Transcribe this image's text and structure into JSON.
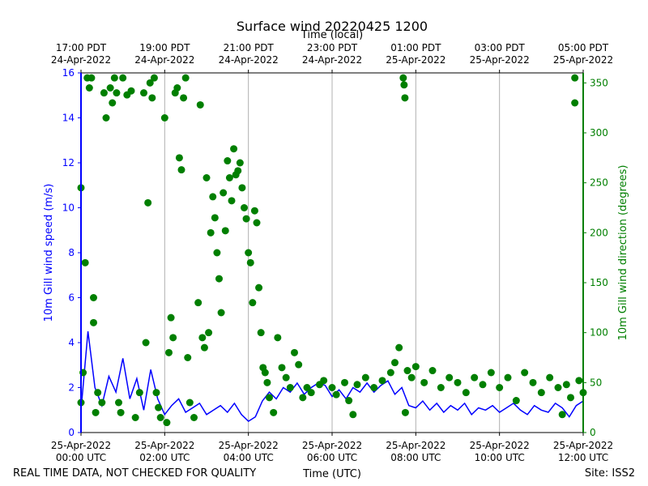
{
  "chart_data": {
    "type": "line+scatter",
    "title": "Surface wind 20220425 1200",
    "top_xlabel": "Time (local)",
    "xlabel": "Time (UTC)",
    "ylabel_left": "10m Gill wind speed (m/s)",
    "ylabel_right": "10m Gill wind direction (degrees)",
    "footer_left": "REAL TIME DATA, NOT CHECKED FOR QUALITY",
    "footer_right": "Site: ISS2",
    "xlim_hours": [
      0,
      12
    ],
    "ylim_left": [
      0,
      16
    ],
    "ylim_right": [
      0,
      360
    ],
    "left_ticks": [
      "0",
      "2",
      "4",
      "6",
      "8",
      "10",
      "12",
      "14",
      "16"
    ],
    "right_ticks": [
      "0",
      "50",
      "100",
      "150",
      "200",
      "250",
      "300",
      "350"
    ],
    "bottom_ticks": [
      [
        "25-Apr-2022",
        "00:00 UTC"
      ],
      [
        "25-Apr-2022",
        "02:00 UTC"
      ],
      [
        "25-Apr-2022",
        "04:00 UTC"
      ],
      [
        "25-Apr-2022",
        "06:00 UTC"
      ],
      [
        "25-Apr-2022",
        "08:00 UTC"
      ],
      [
        "25-Apr-2022",
        "10:00 UTC"
      ],
      [
        "25-Apr-2022",
        "12:00 UTC"
      ]
    ],
    "top_ticks": [
      [
        "17:00 PDT",
        "24-Apr-2022"
      ],
      [
        "19:00 PDT",
        "24-Apr-2022"
      ],
      [
        "21:00 PDT",
        "24-Apr-2022"
      ],
      [
        "23:00 PDT",
        "24-Apr-2022"
      ],
      [
        "01:00 PDT",
        "25-Apr-2022"
      ],
      [
        "03:00 PDT",
        "25-Apr-2022"
      ],
      [
        "05:00 PDT",
        "25-Apr-2022"
      ]
    ],
    "colors": {
      "speed": "#0000ff",
      "direction": "#007f00",
      "grid": "#b0b0b0"
    },
    "speed_interval_min": 10,
    "speed": [
      1.0,
      4.5,
      2.0,
      1.2,
      2.5,
      1.8,
      3.3,
      1.5,
      2.4,
      1.0,
      2.8,
      1.5,
      0.8,
      1.2,
      1.5,
      0.9,
      1.1,
      1.3,
      0.8,
      1.0,
      1.2,
      0.9,
      1.3,
      0.8,
      0.5,
      0.7,
      1.4,
      1.8,
      1.5,
      2.0,
      1.8,
      2.2,
      1.7,
      2.0,
      2.2,
      2.1,
      1.6,
      1.9,
      1.5,
      2.0,
      1.8,
      2.2,
      1.8,
      2.1,
      2.3,
      1.7,
      2.0,
      1.2,
      1.1,
      1.4,
      1.0,
      1.3,
      0.9,
      1.2,
      1.0,
      1.3,
      0.8,
      1.1,
      1.0,
      1.2,
      0.9,
      1.1,
      1.3,
      1.0,
      0.8,
      1.2,
      1.0,
      0.9,
      1.3,
      1.1,
      0.7,
      1.2,
      1.4
    ],
    "direction": [
      [
        0.0,
        245
      ],
      [
        0.0,
        30
      ],
      [
        0.05,
        60
      ],
      [
        0.1,
        170
      ],
      [
        0.15,
        355
      ],
      [
        0.2,
        345
      ],
      [
        0.25,
        355
      ],
      [
        0.3,
        135
      ],
      [
        0.3,
        110
      ],
      [
        0.35,
        20
      ],
      [
        0.4,
        40
      ],
      [
        0.5,
        30
      ],
      [
        0.55,
        340
      ],
      [
        0.6,
        315
      ],
      [
        0.7,
        345
      ],
      [
        0.75,
        330
      ],
      [
        0.8,
        355
      ],
      [
        0.85,
        340
      ],
      [
        0.9,
        30
      ],
      [
        0.95,
        20
      ],
      [
        1.0,
        355
      ],
      [
        1.1,
        338
      ],
      [
        1.2,
        342
      ],
      [
        1.3,
        15
      ],
      [
        1.4,
        40
      ],
      [
        1.5,
        340
      ],
      [
        1.55,
        90
      ],
      [
        1.6,
        230
      ],
      [
        1.65,
        350
      ],
      [
        1.7,
        335
      ],
      [
        1.75,
        355
      ],
      [
        1.8,
        40
      ],
      [
        1.85,
        25
      ],
      [
        1.9,
        15
      ],
      [
        2.0,
        315
      ],
      [
        2.05,
        10
      ],
      [
        2.1,
        80
      ],
      [
        2.15,
        115
      ],
      [
        2.2,
        95
      ],
      [
        2.25,
        340
      ],
      [
        2.3,
        345
      ],
      [
        2.35,
        275
      ],
      [
        2.4,
        263
      ],
      [
        2.45,
        335
      ],
      [
        2.5,
        355
      ],
      [
        2.55,
        75
      ],
      [
        2.6,
        30
      ],
      [
        2.7,
        15
      ],
      [
        2.8,
        130
      ],
      [
        2.85,
        328
      ],
      [
        2.9,
        95
      ],
      [
        2.95,
        85
      ],
      [
        3.0,
        255
      ],
      [
        3.05,
        100
      ],
      [
        3.1,
        200
      ],
      [
        3.15,
        236
      ],
      [
        3.2,
        215
      ],
      [
        3.25,
        180
      ],
      [
        3.3,
        154
      ],
      [
        3.35,
        120
      ],
      [
        3.4,
        240
      ],
      [
        3.45,
        202
      ],
      [
        3.5,
        272
      ],
      [
        3.55,
        255
      ],
      [
        3.6,
        232
      ],
      [
        3.65,
        284
      ],
      [
        3.7,
        258
      ],
      [
        3.75,
        262
      ],
      [
        3.8,
        270
      ],
      [
        3.85,
        245
      ],
      [
        3.9,
        225
      ],
      [
        3.95,
        214
      ],
      [
        4.0,
        180
      ],
      [
        4.05,
        170
      ],
      [
        4.1,
        130
      ],
      [
        4.15,
        222
      ],
      [
        4.2,
        210
      ],
      [
        4.25,
        145
      ],
      [
        4.3,
        100
      ],
      [
        4.35,
        65
      ],
      [
        4.4,
        60
      ],
      [
        4.45,
        50
      ],
      [
        4.5,
        35
      ],
      [
        4.6,
        20
      ],
      [
        4.7,
        95
      ],
      [
        4.8,
        65
      ],
      [
        4.9,
        55
      ],
      [
        5.0,
        45
      ],
      [
        5.1,
        80
      ],
      [
        5.2,
        68
      ],
      [
        5.3,
        35
      ],
      [
        5.4,
        45
      ],
      [
        5.5,
        40
      ],
      [
        5.7,
        48
      ],
      [
        5.8,
        52
      ],
      [
        6.0,
        45
      ],
      [
        6.1,
        38
      ],
      [
        6.3,
        50
      ],
      [
        6.4,
        32
      ],
      [
        6.5,
        18
      ],
      [
        6.6,
        48
      ],
      [
        6.8,
        55
      ],
      [
        7.0,
        45
      ],
      [
        7.2,
        52
      ],
      [
        7.4,
        60
      ],
      [
        7.5,
        70
      ],
      [
        7.6,
        85
      ],
      [
        7.7,
        355
      ],
      [
        7.72,
        348
      ],
      [
        7.74,
        335
      ],
      [
        7.75,
        20
      ],
      [
        7.8,
        62
      ],
      [
        7.9,
        55
      ],
      [
        8.0,
        66
      ],
      [
        8.2,
        50
      ],
      [
        8.4,
        62
      ],
      [
        8.6,
        45
      ],
      [
        8.8,
        55
      ],
      [
        9.0,
        50
      ],
      [
        9.2,
        40
      ],
      [
        9.4,
        55
      ],
      [
        9.6,
        48
      ],
      [
        9.8,
        60
      ],
      [
        10.0,
        45
      ],
      [
        10.2,
        55
      ],
      [
        10.4,
        32
      ],
      [
        10.6,
        60
      ],
      [
        10.8,
        50
      ],
      [
        11.0,
        40
      ],
      [
        11.2,
        55
      ],
      [
        11.4,
        45
      ],
      [
        11.5,
        18
      ],
      [
        11.6,
        48
      ],
      [
        11.7,
        35
      ],
      [
        11.8,
        355
      ],
      [
        11.8,
        330
      ],
      [
        11.9,
        52
      ],
      [
        12.0,
        40
      ]
    ]
  }
}
